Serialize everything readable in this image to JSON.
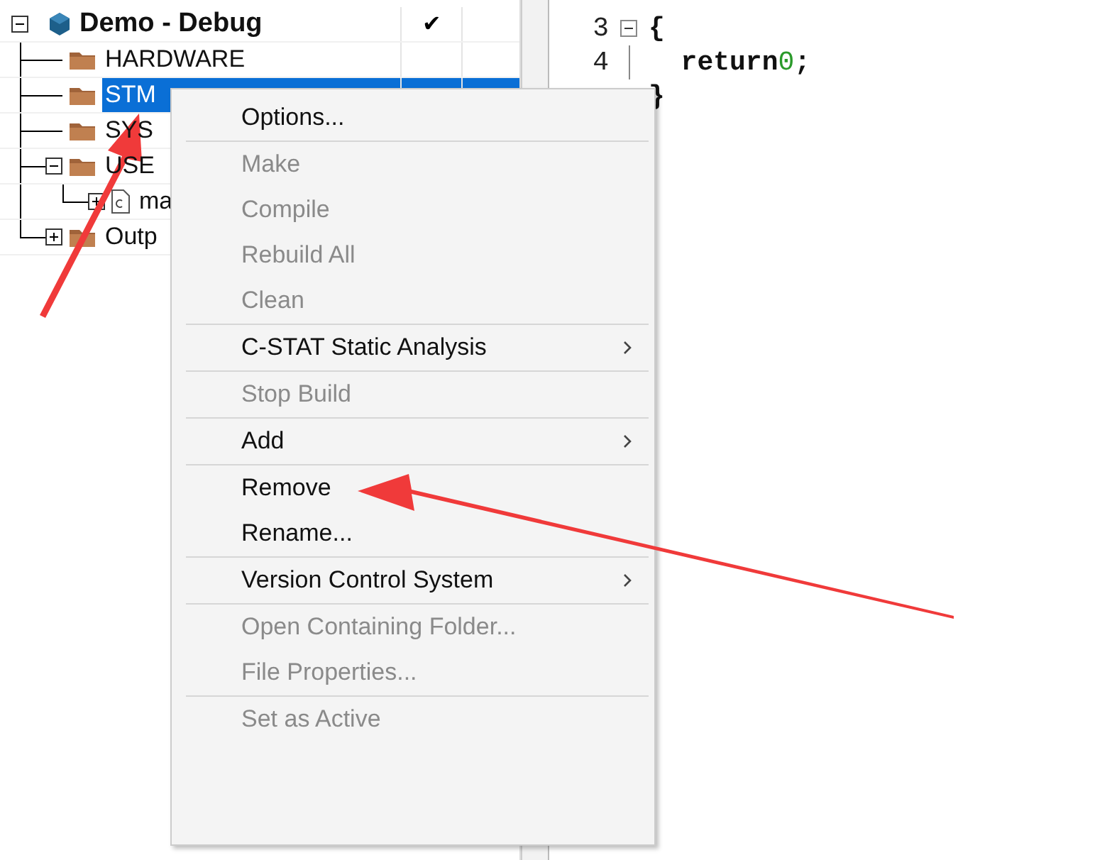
{
  "workspace": {
    "tree": [
      {
        "label": "Demo - Debug",
        "kind": "project",
        "expanded": true,
        "selected": false,
        "check": "✔",
        "children": [
          {
            "label": "HARDWARE",
            "kind": "folder",
            "selected": false
          },
          {
            "label": "STM",
            "kind": "folder",
            "selected": true
          },
          {
            "label": "SYS",
            "kind": "folder",
            "selected": false
          },
          {
            "label": "USE",
            "kind": "folder",
            "selected": false,
            "expanded": true,
            "children": [
              {
                "label": "ma",
                "kind": "file",
                "selected": false,
                "expanded": false
              }
            ]
          },
          {
            "label": "Outp",
            "kind": "folder",
            "selected": false,
            "expanded": false
          }
        ]
      }
    ]
  },
  "editor": {
    "lines": [
      {
        "number": "3",
        "code": "{",
        "kind": "fold_start"
      },
      {
        "number": "4",
        "code": "  return",
        "literal": "0",
        "tail": ";",
        "kind": "fold_body"
      },
      {
        "code": "}",
        "kind": "plain"
      }
    ]
  },
  "context_menu": {
    "items": [
      {
        "kind": "item",
        "label": "Options...",
        "disabled": false,
        "submenu": false
      },
      {
        "kind": "separator"
      },
      {
        "kind": "item",
        "label": "Make",
        "disabled": true,
        "submenu": false
      },
      {
        "kind": "item",
        "label": "Compile",
        "disabled": true,
        "submenu": false
      },
      {
        "kind": "item",
        "label": "Rebuild All",
        "disabled": true,
        "submenu": false
      },
      {
        "kind": "item",
        "label": "Clean",
        "disabled": true,
        "submenu": false
      },
      {
        "kind": "separator"
      },
      {
        "kind": "item",
        "label": "C-STAT Static Analysis",
        "disabled": false,
        "submenu": true
      },
      {
        "kind": "separator"
      },
      {
        "kind": "item",
        "label": "Stop Build",
        "disabled": true,
        "submenu": false
      },
      {
        "kind": "separator"
      },
      {
        "kind": "item",
        "label": "Add",
        "disabled": false,
        "submenu": true
      },
      {
        "kind": "separator"
      },
      {
        "kind": "item",
        "label": "Remove",
        "disabled": false,
        "submenu": false
      },
      {
        "kind": "item",
        "label": "Rename...",
        "disabled": false,
        "submenu": false
      },
      {
        "kind": "separator"
      },
      {
        "kind": "item",
        "label": "Version Control System",
        "disabled": false,
        "submenu": true
      },
      {
        "kind": "separator"
      },
      {
        "kind": "item",
        "label": "Open Containing Folder...",
        "disabled": true,
        "submenu": false
      },
      {
        "kind": "item",
        "label": "File Properties...",
        "disabled": true,
        "submenu": false
      },
      {
        "kind": "separator"
      },
      {
        "kind": "item",
        "label": "Set as Active",
        "disabled": true,
        "submenu": false
      }
    ]
  }
}
